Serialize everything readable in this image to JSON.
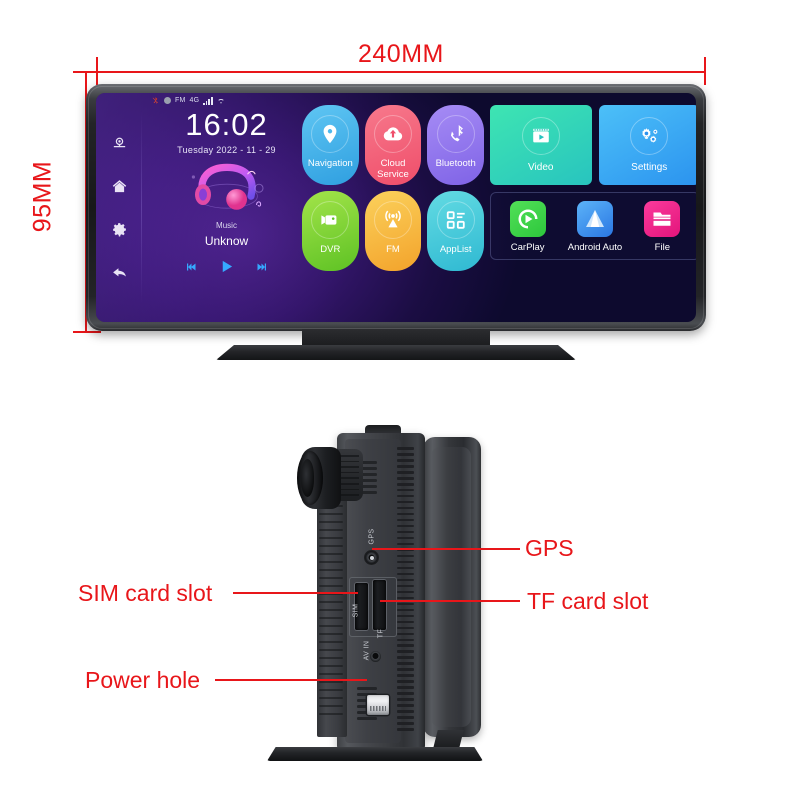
{
  "dimensions": {
    "width_label": "240MM",
    "height_label": "95MM",
    "accent_color": "#e8161a"
  },
  "front_view": {
    "status_bar": {
      "fm_label": "FM",
      "network_label": "4G",
      "icons": [
        "bluetooth-off-icon",
        "record-dot-icon",
        "signal-bars-icon",
        "wifi-icon"
      ]
    },
    "sidebar": [
      {
        "name": "camera-icon",
        "label": "Camera"
      },
      {
        "name": "home-icon",
        "label": "Home"
      },
      {
        "name": "settings-gear-icon",
        "label": "Settings"
      },
      {
        "name": "back-arrow-icon",
        "label": "Back"
      }
    ],
    "clock": {
      "time": "16:02",
      "date": "Tuesday  2022 - 11 - 29"
    },
    "music": {
      "label": "Music",
      "title": "Unknow",
      "prev_label": "Previous",
      "play_label": "Play",
      "next_label": "Next"
    },
    "apps": [
      {
        "label": "Navigation",
        "icon": "map-pin-icon",
        "color_a": "#4fbdf0",
        "color_b": "#2f9fe0"
      },
      {
        "label": "Cloud\nService",
        "icon": "cloud-upload-icon",
        "color_a": "#f4647a",
        "color_b": "#ef4e6a"
      },
      {
        "label": "Bluetooth",
        "icon": "bluetooth-phone-icon",
        "color_a": "#9a7df0",
        "color_b": "#8065e6"
      },
      {
        "label": "DVR",
        "icon": "video-camera-icon",
        "color_a": "#8fdb3a",
        "color_b": "#63c92b"
      },
      {
        "label": "FM",
        "icon": "radio-tower-icon",
        "color_a": "#f9c545",
        "color_b": "#f5a82e"
      },
      {
        "label": "AppList",
        "icon": "grid-apps-icon",
        "color_a": "#4fd3dd",
        "color_b": "#31bcd4"
      }
    ],
    "tiles_large": [
      {
        "label": "Video",
        "icon": "video-play-icon",
        "color_a": "#3de0b5",
        "color_b": "#2ec9ba"
      },
      {
        "label": "Settings",
        "icon": "gears-icon",
        "color_a": "#3fb6f5",
        "color_b": "#2e9ef0"
      }
    ],
    "tiles_small": [
      {
        "label": "CarPlay",
        "icon": "carplay-icon",
        "color_a": "#49dd4f",
        "color_b": "#2fc93f"
      },
      {
        "label": "Android Auto",
        "icon": "android-auto-icon",
        "color_a": "#4aa8f5",
        "color_b": "#2f7fe6"
      },
      {
        "label": "File",
        "icon": "folder-icon",
        "color_a": "#f5288f",
        "color_b": "#e51a7e"
      }
    ]
  },
  "side_view": {
    "ports": [
      {
        "name": "gps-port",
        "label": "GPS"
      },
      {
        "name": "sim-slot",
        "label": "SIM"
      },
      {
        "name": "tf-slot",
        "label": "TF"
      },
      {
        "name": "av-in-jack",
        "label": "AV IN"
      }
    ],
    "callouts": [
      {
        "name": "callout-gps",
        "label": "GPS",
        "side": "right"
      },
      {
        "name": "callout-tf-card-slot",
        "label": "TF card slot",
        "side": "right"
      },
      {
        "name": "callout-sim-card-slot",
        "label": "SIM card slot",
        "side": "left"
      },
      {
        "name": "callout-power-hole",
        "label": "Power hole",
        "side": "left"
      }
    ]
  }
}
